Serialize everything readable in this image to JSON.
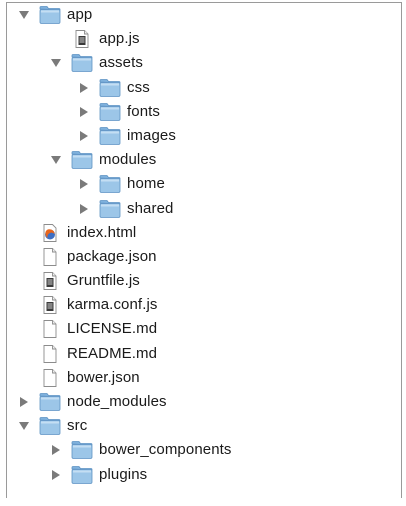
{
  "tree": [
    {
      "label": "app",
      "kind": "folder",
      "depth": 0,
      "state": "open"
    },
    {
      "label": "app.js",
      "kind": "js-file",
      "depth": 1,
      "state": "none"
    },
    {
      "label": "assets",
      "kind": "folder",
      "depth": 1,
      "state": "open"
    },
    {
      "label": "css",
      "kind": "folder",
      "depth": 2,
      "state": "closed"
    },
    {
      "label": "fonts",
      "kind": "folder",
      "depth": 2,
      "state": "closed"
    },
    {
      "label": "images",
      "kind": "folder",
      "depth": 2,
      "state": "closed"
    },
    {
      "label": "modules",
      "kind": "folder",
      "depth": 1,
      "state": "open"
    },
    {
      "label": "home",
      "kind": "folder",
      "depth": 2,
      "state": "closed"
    },
    {
      "label": "shared",
      "kind": "folder",
      "depth": 2,
      "state": "closed"
    },
    {
      "label": "index.html",
      "kind": "html-file",
      "depth": 0,
      "state": "none"
    },
    {
      "label": "package.json",
      "kind": "blank-file",
      "depth": 0,
      "state": "none"
    },
    {
      "label": "Gruntfile.js",
      "kind": "js-file",
      "depth": 0,
      "state": "none"
    },
    {
      "label": "karma.conf.js",
      "kind": "js-file",
      "depth": 0,
      "state": "none"
    },
    {
      "label": "LICENSE.md",
      "kind": "blank-file",
      "depth": 0,
      "state": "none"
    },
    {
      "label": "README.md",
      "kind": "blank-file",
      "depth": 0,
      "state": "none"
    },
    {
      "label": "bower.json",
      "kind": "blank-file",
      "depth": 0,
      "state": "none"
    },
    {
      "label": "node_modules",
      "kind": "folder",
      "depth": 0,
      "state": "closed"
    },
    {
      "label": "src",
      "kind": "folder",
      "depth": 0,
      "state": "open"
    },
    {
      "label": "bower_components",
      "kind": "folder",
      "depth": 1,
      "state": "closed"
    },
    {
      "label": "plugins",
      "kind": "folder",
      "depth": 1,
      "state": "closed"
    }
  ],
  "colors": {
    "folder_body": "#9cc6e8",
    "folder_tab": "#7fb1dd",
    "folder_edge": "#5f93c3",
    "disclosure": "#7a7a7a",
    "html_icon_orange": "#e8661c",
    "html_icon_blue": "#3d6fc4"
  }
}
